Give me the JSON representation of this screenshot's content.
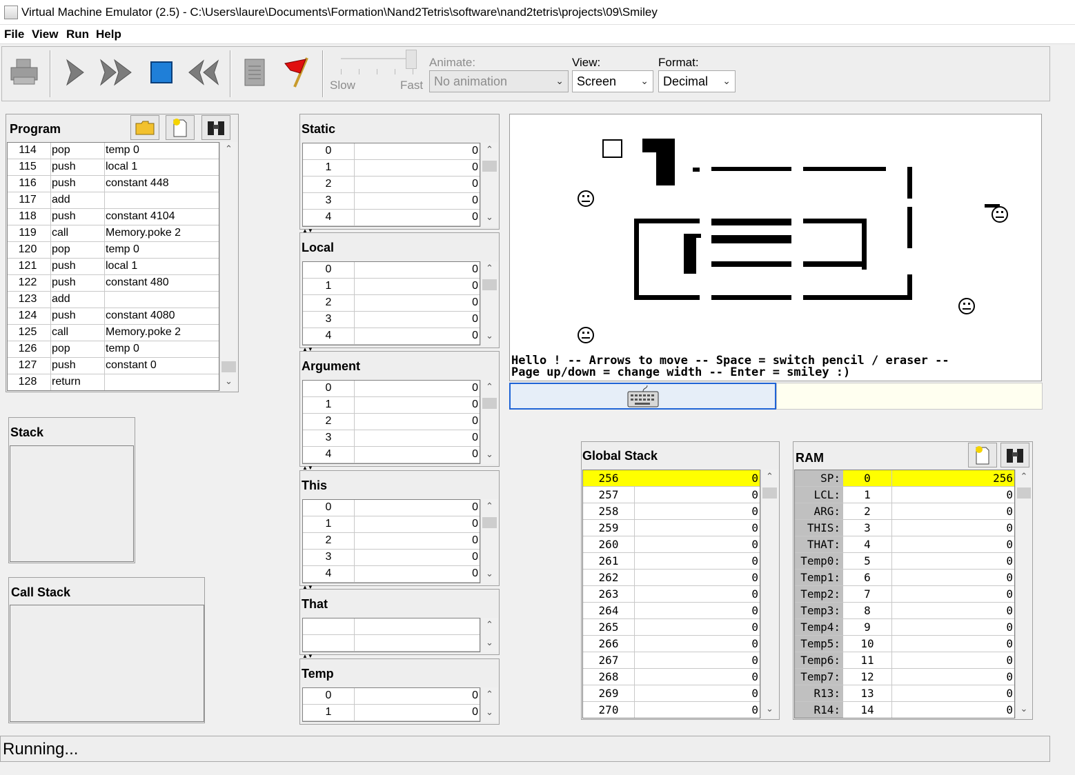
{
  "window": {
    "title": "Virtual Machine Emulator (2.5) - C:\\Users\\laure\\Documents\\Formation\\Nand2Tetris\\software\\nand2tetris\\projects\\09\\Smiley"
  },
  "menu": [
    "File",
    "View",
    "Run",
    "Help"
  ],
  "toolbar": {
    "speed_slow": "Slow",
    "speed_fast": "Fast",
    "animate_label": "Animate:",
    "animate_value": "No animation",
    "view_label": "View:",
    "view_value": "Screen",
    "format_label": "Format:",
    "format_value": "Decimal"
  },
  "program": {
    "title": "Program",
    "rows": [
      [
        "114",
        "pop",
        "temp 0"
      ],
      [
        "115",
        "push",
        "local 1"
      ],
      [
        "116",
        "push",
        "constant 448"
      ],
      [
        "117",
        "add",
        ""
      ],
      [
        "118",
        "push",
        "constant 4104"
      ],
      [
        "119",
        "call",
        "Memory.poke 2"
      ],
      [
        "120",
        "pop",
        "temp 0"
      ],
      [
        "121",
        "push",
        "local 1"
      ],
      [
        "122",
        "push",
        "constant 480"
      ],
      [
        "123",
        "add",
        ""
      ],
      [
        "124",
        "push",
        "constant 4080"
      ],
      [
        "125",
        "call",
        "Memory.poke 2"
      ],
      [
        "126",
        "pop",
        "temp 0"
      ],
      [
        "127",
        "push",
        "constant 0"
      ],
      [
        "128",
        "return",
        ""
      ]
    ]
  },
  "stack": {
    "title": "Stack"
  },
  "call_stack": {
    "title": "Call Stack"
  },
  "segments": [
    {
      "title": "Static",
      "rows": [
        [
          "0",
          "0"
        ],
        [
          "1",
          "0"
        ],
        [
          "2",
          "0"
        ],
        [
          "3",
          "0"
        ],
        [
          "4",
          "0"
        ]
      ]
    },
    {
      "title": "Local",
      "rows": [
        [
          "0",
          "0"
        ],
        [
          "1",
          "0"
        ],
        [
          "2",
          "0"
        ],
        [
          "3",
          "0"
        ],
        [
          "4",
          "0"
        ]
      ]
    },
    {
      "title": "Argument",
      "rows": [
        [
          "0",
          "0"
        ],
        [
          "1",
          "0"
        ],
        [
          "2",
          "0"
        ],
        [
          "3",
          "0"
        ],
        [
          "4",
          "0"
        ]
      ]
    },
    {
      "title": "This",
      "rows": [
        [
          "0",
          "0"
        ],
        [
          "1",
          "0"
        ],
        [
          "2",
          "0"
        ],
        [
          "3",
          "0"
        ],
        [
          "4",
          "0"
        ]
      ]
    },
    {
      "title": "That",
      "rows": [
        [
          "",
          ""
        ],
        [
          "",
          ""
        ]
      ]
    },
    {
      "title": "Temp",
      "rows": [
        [
          "0",
          "0"
        ],
        [
          "1",
          "0"
        ]
      ]
    }
  ],
  "screen": {
    "line1": "Hello ! -- Arrows to move -- Space = switch pencil / eraser --",
    "line2": "Page up/down = change width -- Enter = smiley :)"
  },
  "global_stack": {
    "title": "Global Stack",
    "rows": [
      [
        "256",
        "0"
      ],
      [
        "257",
        "0"
      ],
      [
        "258",
        "0"
      ],
      [
        "259",
        "0"
      ],
      [
        "260",
        "0"
      ],
      [
        "261",
        "0"
      ],
      [
        "262",
        "0"
      ],
      [
        "263",
        "0"
      ],
      [
        "264",
        "0"
      ],
      [
        "265",
        "0"
      ],
      [
        "266",
        "0"
      ],
      [
        "267",
        "0"
      ],
      [
        "268",
        "0"
      ],
      [
        "269",
        "0"
      ],
      [
        "270",
        "0"
      ]
    ]
  },
  "ram": {
    "title": "RAM",
    "rows": [
      [
        "SP:",
        "0",
        "256"
      ],
      [
        "LCL:",
        "1",
        "0"
      ],
      [
        "ARG:",
        "2",
        "0"
      ],
      [
        "THIS:",
        "3",
        "0"
      ],
      [
        "THAT:",
        "4",
        "0"
      ],
      [
        "Temp0:",
        "5",
        "0"
      ],
      [
        "Temp1:",
        "6",
        "0"
      ],
      [
        "Temp2:",
        "7",
        "0"
      ],
      [
        "Temp3:",
        "8",
        "0"
      ],
      [
        "Temp4:",
        "9",
        "0"
      ],
      [
        "Temp5:",
        "10",
        "0"
      ],
      [
        "Temp6:",
        "11",
        "0"
      ],
      [
        "Temp7:",
        "12",
        "0"
      ],
      [
        "R13:",
        "13",
        "0"
      ],
      [
        "R14:",
        "14",
        "0"
      ]
    ]
  },
  "status": "Running...",
  "colors": {
    "highlight": "#ffff00",
    "keyboard_focus": "#1e63d6",
    "keyboard_bg": "#e6eef8",
    "input_bg": "#fffff0"
  }
}
